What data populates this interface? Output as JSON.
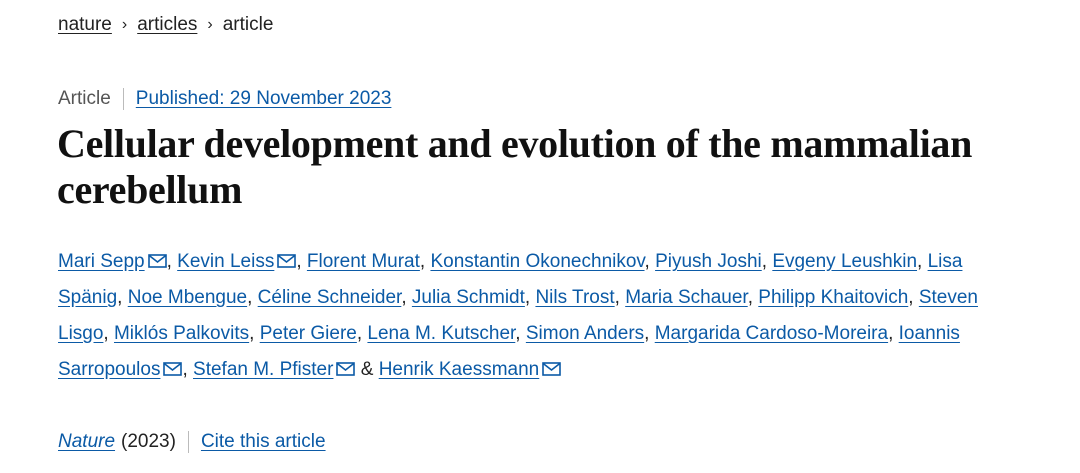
{
  "breadcrumb": {
    "items": [
      "nature",
      "articles",
      "article"
    ],
    "separator": "›"
  },
  "meta": {
    "type": "Article",
    "published": "Published: 29 November 2023"
  },
  "title": "Cellular development and evolution of the mammalian cerebellum",
  "authors": [
    {
      "name": "Mari Sepp",
      "email": true,
      "sep": ", "
    },
    {
      "name": "Kevin Leiss",
      "email": true,
      "sep": ", "
    },
    {
      "name": "Florent Murat",
      "email": false,
      "sep": ", "
    },
    {
      "name": "Konstantin Okonechnikov",
      "email": false,
      "sep": ", "
    },
    {
      "name": "Piyush Joshi",
      "email": false,
      "sep": ", "
    },
    {
      "name": "Evgeny Leushkin",
      "email": false,
      "sep": ", "
    },
    {
      "name": "Lisa Spänig",
      "email": false,
      "sep": ", "
    },
    {
      "name": "Noe Mbengue",
      "email": false,
      "sep": ", "
    },
    {
      "name": "Céline Schneider",
      "email": false,
      "sep": ", "
    },
    {
      "name": "Julia Schmidt",
      "email": false,
      "sep": ", "
    },
    {
      "name": "Nils Trost",
      "email": false,
      "sep": ", "
    },
    {
      "name": "Maria Schauer",
      "email": false,
      "sep": ", "
    },
    {
      "name": "Philipp Khaitovich",
      "email": false,
      "sep": ", "
    },
    {
      "name": "Steven Lisgo",
      "email": false,
      "sep": ", "
    },
    {
      "name": "Miklós Palkovits",
      "email": false,
      "sep": ", "
    },
    {
      "name": "Peter Giere",
      "email": false,
      "sep": ", "
    },
    {
      "name": "Lena M. Kutscher",
      "email": false,
      "sep": ", "
    },
    {
      "name": "Simon Anders",
      "email": false,
      "sep": ", "
    },
    {
      "name": "Margarida Cardoso-Moreira",
      "email": false,
      "sep": ", "
    },
    {
      "name": "Ioannis Sarropoulos",
      "email": true,
      "sep": ", "
    },
    {
      "name": "Stefan M. Pfister",
      "email": true,
      "sep": " & "
    },
    {
      "name": "Henrik Kaessmann",
      "email": true,
      "sep": ""
    }
  ],
  "footer": {
    "journal": "Nature",
    "year": "(2023)",
    "cite": "Cite this article"
  },
  "colors": {
    "link": "#0b5aa6",
    "text": "#222222",
    "title": "#111111",
    "divider": "#bbbbbb"
  },
  "icons": {
    "email": "envelope-icon",
    "separator": "chevron-right-icon"
  }
}
